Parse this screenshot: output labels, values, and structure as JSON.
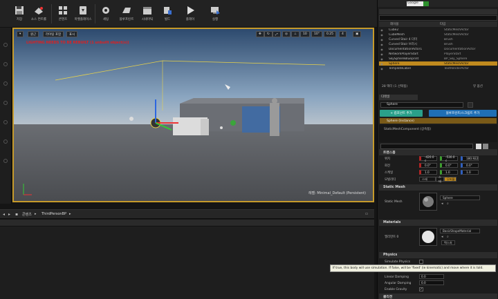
{
  "toolbar": {
    "buttons": [
      {
        "label": "저장"
      },
      {
        "label": "소스 컨트롤"
      },
      {
        "label": "콘텐츠"
      },
      {
        "label": "마켓플레이스"
      },
      {
        "label": "세팅"
      },
      {
        "label": "블루프린트"
      },
      {
        "label": "시네마틱"
      },
      {
        "label": "빌드"
      },
      {
        "label": "플레이"
      },
      {
        "label": "실행"
      }
    ]
  },
  "viewport": {
    "perspective_btn": "원근",
    "lit_btn": "라이팅 포함",
    "show_btn": "표시",
    "grid_snap": "10",
    "rot_snap": "10°",
    "scale_snap": "0.25",
    "cam_speed": "4",
    "lighting_warning": "LIGHTING NEEDS TO BE REBUILT (1 unbuilt object(s))",
    "level_label": "레벨: Minimal_Default (Persistent)"
  },
  "bottom_nav": {
    "root": "콘텐츠",
    "folder": "ThirdPersonBP"
  },
  "search": {
    "engine": "Google"
  },
  "outliner": {
    "col_label": "레이블",
    "col_type": "타입",
    "rows": [
      {
        "name": "Cube2",
        "type": "StaticMeshActor",
        "selected": false
      },
      {
        "name": "CubeMesh",
        "type": "StaticMeshActor",
        "selected": false
      },
      {
        "name": "Curved Stair 4 더미",
        "type": "Brush",
        "selected": false
      },
      {
        "name": "Curved Stair 브러시",
        "type": "Brush",
        "selected": false
      },
      {
        "name": "DocumentationActor1",
        "type": "DocumentationActor",
        "selected": false
      },
      {
        "name": "NetworkPlayerStart",
        "type": "PlayerStart",
        "selected": false
      },
      {
        "name": "SkySphereBlueprint",
        "type": "BP_Sky_Sphere",
        "selected": false
      },
      {
        "name": "Sphere",
        "type": "StaticMeshActor",
        "selected": true
      },
      {
        "name": "TemplateLabel",
        "type": "TextRenderActor",
        "selected": false
      }
    ],
    "footer": "28 액터 (1 선택됨)",
    "view_options": "뷰 옵션"
  },
  "details": {
    "tab": "디테일",
    "actor_name": "Sphere",
    "add_component": "+ 컴포넌트 추가",
    "blueprint_script": "블루프린트/스크립트 추가",
    "instance": "Sphere (Instance)",
    "component": "StaticMeshComponent (상속됨)",
    "transform": {
      "section": "트랜스폼",
      "location_label": "위치",
      "rotation_label": "회전",
      "scale_label": "스케일",
      "mobility_label": "모빌리티",
      "location": [
        "-420.0 c",
        "-530.0 c",
        "180.922"
      ],
      "rotation": [
        "0.0°",
        "0.0°",
        "0.0°"
      ],
      "scale": [
        "1.0",
        "1.0",
        "1.0"
      ],
      "mobility_static": "스태",
      "mobility_stationary": "스테",
      "mobility_movable": "무버블"
    },
    "static_mesh": {
      "section": "Static Mesh",
      "label": "Static Mesh",
      "value": "Sphere"
    },
    "materials": {
      "section": "Materials",
      "label": "엘리먼트 0",
      "value": "BasicShapeMaterial",
      "texture_btn": "텍스처"
    },
    "physics": {
      "section": "Physics",
      "simulate_label": "Simulate Physics",
      "linear_damping_label": "Linear Damping",
      "linear_damping": "0.0",
      "angular_damping_label": "Angular Damping",
      "angular_damping": "0.0",
      "enable_gravity_label": "Enable Gravity",
      "next_section": "콜리전"
    },
    "tooltip": "If true, this body will use simulation. If false, will be 'fixed' (ie kinematic) and move where it is told."
  },
  "colors": {
    "selection": "#c08a1e",
    "add_component": "#2aa08a",
    "blueprint": "#1f6fb5",
    "viewport_border": "#c79b2a",
    "warning": "#e02020"
  }
}
